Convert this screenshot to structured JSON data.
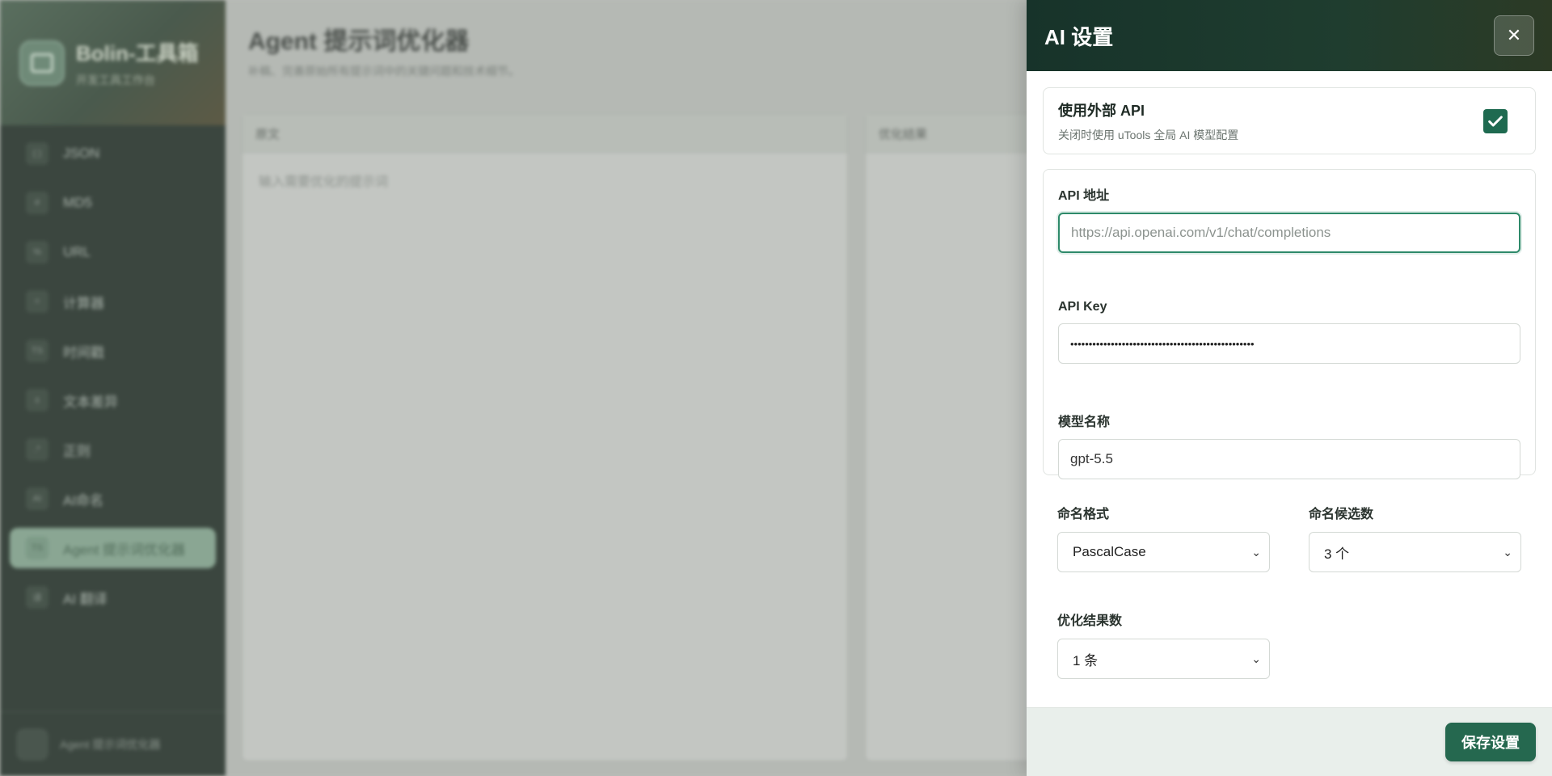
{
  "app": {
    "title": "Bolin-工具箱",
    "subtitle": "开发工具工作台"
  },
  "sidebar": {
    "items": [
      {
        "icon": "{ }",
        "label": "JSON",
        "active": false
      },
      {
        "icon": "#",
        "label": "MD5",
        "active": false
      },
      {
        "icon": "%",
        "label": "URL",
        "active": false
      },
      {
        "icon": "=",
        "label": "计算器",
        "active": false
      },
      {
        "icon": "TS",
        "label": "时间戳",
        "active": false
      },
      {
        "icon": "±",
        "label": "文本差异",
        "active": false
      },
      {
        "icon": ".*",
        "label": "正则",
        "active": false
      },
      {
        "icon": "AI",
        "label": "AI命名",
        "active": false
      },
      {
        "icon": "TS",
        "label": "Agent 提示词优化器",
        "active": true
      },
      {
        "icon": "译",
        "label": "AI 翻译",
        "active": false
      }
    ],
    "footer_label": "Agent 提示词优化器"
  },
  "main": {
    "title": "Agent 提示词优化器",
    "subtitle": "补稿、完善原始所有提示词中的关键问题和技术细节。",
    "left_pane": {
      "header": "原文",
      "placeholder": "输入需要优化的提示词"
    },
    "right_pane": {
      "header": "优化结果"
    }
  },
  "drawer": {
    "title": "AI 设置",
    "close_label": "✕",
    "toggle": {
      "title": "使用外部 API",
      "description": "关闭时使用 uTools 全局 AI 模型配置",
      "checked": true
    },
    "api_url": {
      "label": "API 地址",
      "placeholder": "https://api.openai.com/v1/chat/completions",
      "value": ""
    },
    "api_key": {
      "label": "API Key",
      "value": "••••••••••••••••••••••••••••••••••••••••••••••••••"
    },
    "model": {
      "label": "模型名称",
      "value": "gpt-5.5"
    },
    "naming_format": {
      "label": "命名格式",
      "value": "PascalCase"
    },
    "naming_count": {
      "label": "命名候选数",
      "value": "3 个"
    },
    "result_count": {
      "label": "优化结果数",
      "value": "1 条"
    },
    "save_label": "保存设置"
  },
  "colors": {
    "accent": "#25684f",
    "header_dark": "#17332a",
    "focus_border": "#2e8a6a"
  }
}
